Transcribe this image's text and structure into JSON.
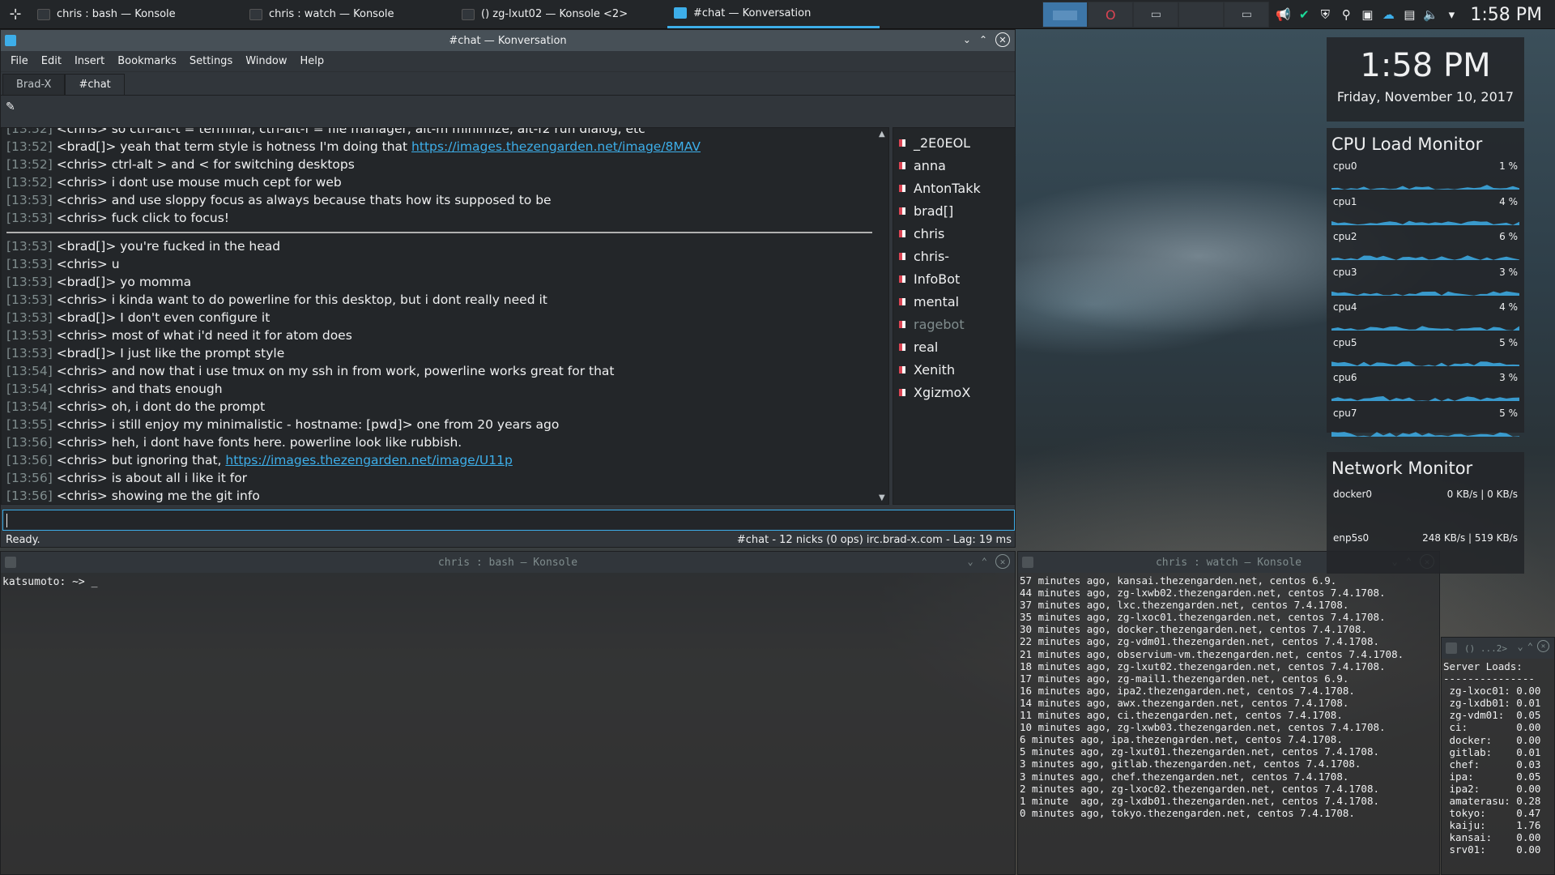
{
  "taskbar": {
    "tasks": [
      {
        "label": "chris : bash — Konsole",
        "active": false
      },
      {
        "label": "chris : watch — Konsole",
        "active": false
      },
      {
        "label": "() zg-lxut02 — Konsole <2>",
        "active": false
      },
      {
        "label": "#chat — Konversation",
        "active": true
      }
    ],
    "clock": "1:58 PM"
  },
  "konversation": {
    "title": "#chat — Konversation",
    "menu": [
      "File",
      "Edit",
      "Insert",
      "Bookmarks",
      "Settings",
      "Window",
      "Help"
    ],
    "tabs": [
      "Brad-X",
      "#chat"
    ],
    "topic_icon": "✎",
    "messages_before": [
      {
        "ts": "[13:52]",
        "text": " <chris> so ctrl-alt-t = terminal, ctrl-alt-f = file manager, alt-m minimize, alt-f2 run dialog, etc"
      },
      {
        "ts": "[13:52]",
        "text": " <brad[]> yeah that term style is hotness I'm doing that ",
        "link": "https://images.thezengarden.net/image/8MAV"
      },
      {
        "ts": "[13:52]",
        "text": " <chris> ctrl-alt > and < for switching desktops"
      },
      {
        "ts": "[13:52]",
        "text": " <chris> i dont use mouse much cept for web"
      },
      {
        "ts": "[13:53]",
        "text": " <chris> and use sloppy focus as always because thats how its supposed to be"
      },
      {
        "ts": "[13:53]",
        "text": " <chris> fuck click to focus!"
      }
    ],
    "messages_after": [
      {
        "ts": "[13:53]",
        "text": " <brad[]> you're fucked in the head"
      },
      {
        "ts": "[13:53]",
        "text": " <chris> u"
      },
      {
        "ts": "[13:53]",
        "text": " <brad[]> yo momma"
      },
      {
        "ts": "[13:53]",
        "text": " <chris> i kinda want to do powerline for this desktop, but i dont really need it"
      },
      {
        "ts": "[13:53]",
        "text": " <brad[]> I don't even configure it"
      },
      {
        "ts": "[13:53]",
        "text": " <chris> most of what i'd need it for atom does"
      },
      {
        "ts": "[13:53]",
        "text": " <brad[]> I just like the prompt style"
      },
      {
        "ts": "[13:54]",
        "text": " <chris> and now that i use tmux on my ssh in from work, powerline works great for that"
      },
      {
        "ts": "[13:54]",
        "text": " <chris> and thats enough"
      },
      {
        "ts": "[13:54]",
        "text": " <chris> oh, i dont do the prompt"
      },
      {
        "ts": "[13:55]",
        "text": " <chris> i still enjoy my minimalistic - hostname: [pwd]> one from 20 years ago"
      },
      {
        "ts": "[13:56]",
        "text": " <chris> heh, i dont have fonts here. powerline look like rubbish."
      },
      {
        "ts": "[13:56]",
        "text": " <chris> but ignoring that, ",
        "link": "https://images.thezengarden.net/image/U11p"
      },
      {
        "ts": "[13:56]",
        "text": " <chris> is about all i like it for"
      },
      {
        "ts": "[13:56]",
        "text": " <chris> showing me the git info"
      }
    ],
    "nicks": [
      {
        "name": "_2E0EOL",
        "away": false
      },
      {
        "name": "anna",
        "away": false
      },
      {
        "name": "AntonTakk",
        "away": false
      },
      {
        "name": "brad[]",
        "away": false
      },
      {
        "name": "chris",
        "away": false
      },
      {
        "name": "chris-",
        "away": false
      },
      {
        "name": "InfoBot",
        "away": false
      },
      {
        "name": "mental",
        "away": false
      },
      {
        "name": "ragebot",
        "away": true
      },
      {
        "name": "real",
        "away": false
      },
      {
        "name": "Xenith",
        "away": false
      },
      {
        "name": "XgizmoX",
        "away": false
      }
    ],
    "status_left": "Ready.",
    "status_right": "#chat - 12 nicks (0 ops)  irc.brad-x.com - Lag: 19 ms"
  },
  "konsole_bash": {
    "title": "chris : bash — Konsole",
    "prompt": "katsumoto: ~> _"
  },
  "konsole_watch": {
    "title": "chris : watch — Konsole",
    "lines": [
      "57 minutes ago, kansai.thezengarden.net, centos 6.9.",
      "44 minutes ago, zg-lxwb02.thezengarden.net, centos 7.4.1708.",
      "37 minutes ago, lxc.thezengarden.net, centos 7.4.1708.",
      "35 minutes ago, zg-lxoc01.thezengarden.net, centos 7.4.1708.",
      "30 minutes ago, docker.thezengarden.net, centos 7.4.1708.",
      "22 minutes ago, zg-vdm01.thezengarden.net, centos 7.4.1708.",
      "21 minutes ago, observium-vm.thezengarden.net, centos 7.4.1708.",
      "18 minutes ago, zg-lxut02.thezengarden.net, centos 7.4.1708.",
      "17 minutes ago, zg-mail1.thezengarden.net, centos 6.9.",
      "16 minutes ago, ipa2.thezengarden.net, centos 7.4.1708.",
      "14 minutes ago, awx.thezengarden.net, centos 7.4.1708.",
      "11 minutes ago, ci.thezengarden.net, centos 7.4.1708.",
      "10 minutes ago, zg-lxwb03.thezengarden.net, centos 7.4.1708.",
      "6 minutes ago, ipa.thezengarden.net, centos 7.4.1708.",
      "5 minutes ago, zg-lxut01.thezengarden.net, centos 7.4.1708.",
      "3 minutes ago, gitlab.thezengarden.net, centos 7.4.1708.",
      "3 minutes ago, chef.thezengarden.net, centos 7.4.1708.",
      "2 minutes ago, zg-lxoc02.thezengarden.net, centos 7.4.1708.",
      "1 minute  ago, zg-lxdb01.thezengarden.net, centos 7.4.1708.",
      "0 minutes ago, tokyo.thezengarden.net, centos 7.4.1708."
    ]
  },
  "konsole_loads": {
    "title": "() ...2>",
    "lines": [
      "Server Loads:",
      "---------------",
      " zg-lxoc01: 0.00",
      " zg-lxdb01: 0.01",
      " zg-vdm01:  0.05",
      " ci:        0.00",
      " docker:    0.00",
      " gitlab:    0.01",
      " chef:      0.03",
      " ipa:       0.05",
      " ipa2:      0.00",
      " amaterasu: 0.28",
      " tokyo:     0.47",
      " kaiju:     1.76",
      " kansai:    0.00",
      " srv01:     0.00"
    ]
  },
  "widgets": {
    "clock_time": "1:58 PM",
    "clock_date": "Friday, November 10, 2017",
    "cpu_title": "CPU Load Monitor",
    "cpus": [
      {
        "name": "cpu0",
        "value": "1 %"
      },
      {
        "name": "cpu1",
        "value": "4 %"
      },
      {
        "name": "cpu2",
        "value": "6 %"
      },
      {
        "name": "cpu3",
        "value": "3 %"
      },
      {
        "name": "cpu4",
        "value": "4 %"
      },
      {
        "name": "cpu5",
        "value": "5 %"
      },
      {
        "name": "cpu6",
        "value": "3 %"
      },
      {
        "name": "cpu7",
        "value": "5 %"
      }
    ],
    "net_title": "Network Monitor",
    "nets": [
      {
        "name": "docker0",
        "value": "0 KB/s | 0 KB/s"
      },
      {
        "name": "enp5s0",
        "value": "248 KB/s | 519 KB/s"
      }
    ]
  }
}
